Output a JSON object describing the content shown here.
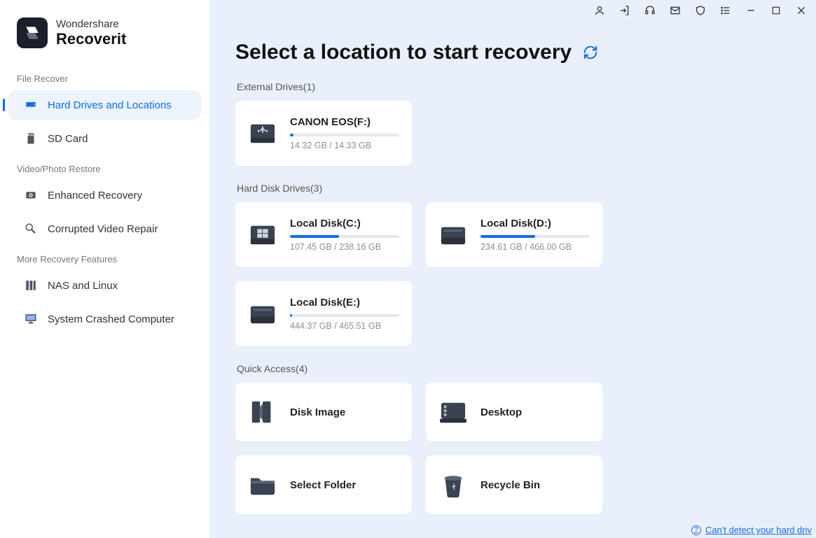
{
  "brand": {
    "line1": "Wondershare",
    "line2": "Recoverit"
  },
  "sidebar": {
    "sections": [
      {
        "label": "File Recover",
        "items": [
          {
            "id": "hard-drives",
            "label": "Hard Drives and Locations",
            "active": true
          },
          {
            "id": "sd-card",
            "label": "SD Card"
          }
        ]
      },
      {
        "label": "Video/Photo Restore",
        "items": [
          {
            "id": "enhanced-recovery",
            "label": "Enhanced Recovery"
          },
          {
            "id": "corrupted-video",
            "label": "Corrupted Video Repair"
          }
        ]
      },
      {
        "label": "More Recovery Features",
        "items": [
          {
            "id": "nas-linux",
            "label": "NAS and Linux"
          },
          {
            "id": "crashed",
            "label": "System Crashed Computer"
          }
        ]
      }
    ]
  },
  "page": {
    "title": "Select a location to start recovery",
    "external_label": "External Drives(1)",
    "hdd_label": "Hard Disk Drives(3)",
    "quick_label": "Quick Access(4)",
    "footer_link": "Can't detect your hard driv"
  },
  "external": [
    {
      "name": "CANON EOS(F:)",
      "used": "14.32 GB",
      "total": "14.33 GB",
      "pct": 3
    }
  ],
  "hdd": [
    {
      "name": "Local Disk(C:)",
      "used": "107.45 GB",
      "total": "238.16 GB",
      "pct": 45
    },
    {
      "name": "Local Disk(D:)",
      "used": "234.61 GB",
      "total": "466.00 GB",
      "pct": 50
    },
    {
      "name": "Local Disk(E:)",
      "used": "444.37 GB",
      "total": "465.51 GB",
      "pct": 2
    }
  ],
  "quick": [
    {
      "id": "disk-image",
      "label": "Disk Image"
    },
    {
      "id": "desktop",
      "label": "Desktop"
    },
    {
      "id": "select-folder",
      "label": "Select Folder"
    },
    {
      "id": "recycle-bin",
      "label": "Recycle Bin"
    }
  ]
}
